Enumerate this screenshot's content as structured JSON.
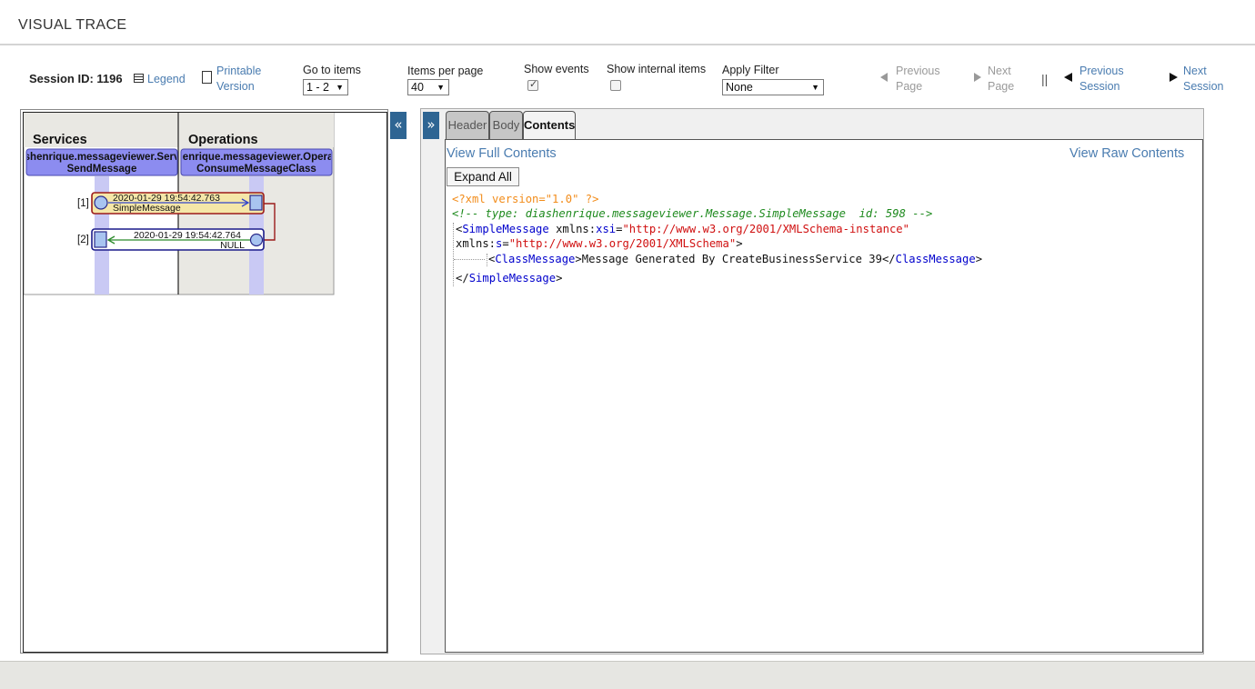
{
  "page": {
    "title": "VISUAL TRACE"
  },
  "toolbar": {
    "session_id": "Session ID: 1196",
    "legend": "Legend",
    "printable_line1": "Printable",
    "printable_line2": "Version",
    "goto_label": "Go to items",
    "goto_value": "1 - 2",
    "per_page_label": "Items per page",
    "per_page_value": "40",
    "show_events_label": "Show events",
    "show_events_checked": true,
    "show_internal_label": "Show internal items",
    "show_internal_checked": false,
    "filter_label": "Apply Filter",
    "filter_value": "None",
    "prev_page_1": "Previous",
    "prev_page_2": "Page",
    "next_page_1": "Next",
    "next_page_2": "Page",
    "separator": "||",
    "prev_session_1": "Previous",
    "prev_session_2": "Session",
    "next_session_1": "Next",
    "next_session_2": "Session"
  },
  "diagram": {
    "columns": [
      {
        "header": "Services",
        "host_line1": "ishenrique.messageviewer.Servi",
        "host_line2": "SendMessage"
      },
      {
        "header": "Operations",
        "host_line1": "ıenrique.messageviewer.Opera",
        "host_line2": "ConsumeMessageClass"
      }
    ],
    "messages": [
      {
        "index": "[1]",
        "time": "2020-01-29 19:54:42.763",
        "label": "SimpleMessage",
        "direction": "request"
      },
      {
        "index": "[2]",
        "time": "2020-01-29 19:54:42.764",
        "label": "NULL",
        "direction": "response"
      }
    ],
    "colors": {
      "request": "#9b1a1a",
      "response": "#1a1a8a",
      "arrow_req": "#3344cc",
      "arrow_resp": "#2a8a2a",
      "host_fill": "#8c8cf0"
    }
  },
  "controls": {
    "collapse_left": "«",
    "expand_right": "»"
  },
  "tabs": [
    {
      "label": "Header",
      "active": false
    },
    {
      "label": "Body",
      "active": false
    },
    {
      "label": "Contents",
      "active": true
    }
  ],
  "contents": {
    "view_full": "View Full Contents",
    "view_raw": "View Raw Contents",
    "expand_all": "Expand All",
    "xml": {
      "pi": "<?xml version=\"1.0\" ?>",
      "comment": "<!-- type: diashenrique.messageviewer.Message.SimpleMessage  id: 598 -->",
      "root_tag": "SimpleMessage",
      "attr1_prefix": "xmlns:",
      "attr1_ns": "xsi",
      "attr1_value": "\"http://www.w3.org/2001/XMLSchema-instance\"",
      "attr2_prefix": "xmlns:",
      "attr2_ns": "s",
      "attr2_value": "\"http://www.w3.org/2001/XMLSchema\"",
      "child_tag": "ClassMessage",
      "child_text": "Message Generated By CreateBusinessService 39"
    }
  }
}
